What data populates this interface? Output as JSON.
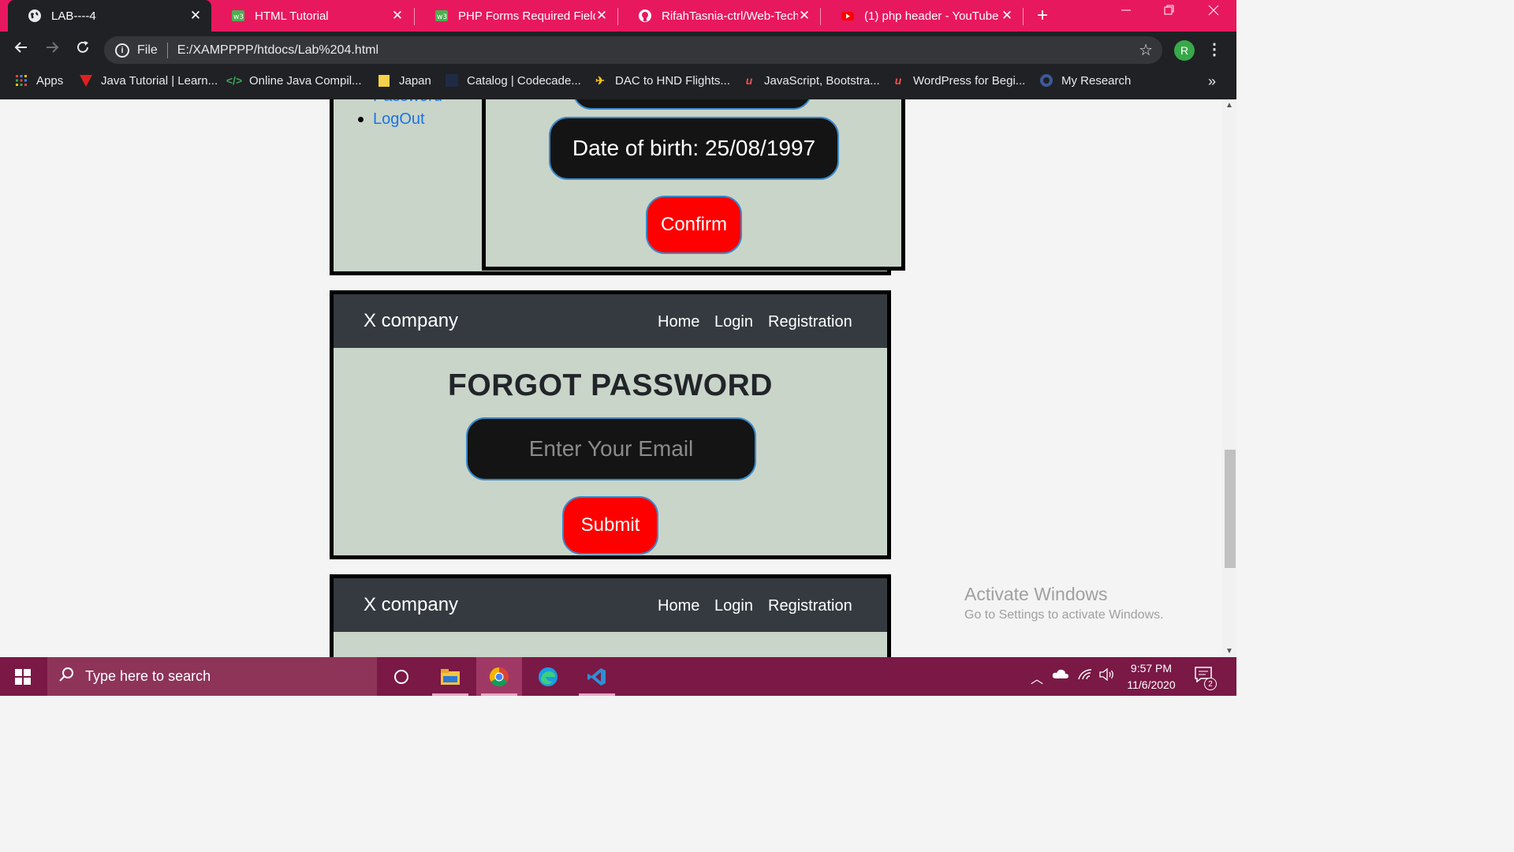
{
  "browser": {
    "tabs": [
      {
        "title": "LAB----4",
        "icon": "globe-icon",
        "active": true
      },
      {
        "title": "HTML Tutorial",
        "icon": "w3schools-icon",
        "active": false
      },
      {
        "title": "PHP Forms Required Fields",
        "icon": "w3schools-icon",
        "active": false
      },
      {
        "title": "RifahTasnia-ctrl/Web-Techn",
        "icon": "github-icon",
        "active": false
      },
      {
        "title": "(1) php header - YouTube",
        "icon": "youtube-icon",
        "active": false
      }
    ],
    "close_glyph": "✕",
    "new_tab_glyph": "+",
    "address": {
      "scheme_label": "File",
      "url": "E:/XAMPPPP/htdocs/Lab%204.html"
    },
    "profile_initial": "R",
    "bookmarks": [
      {
        "label": "Apps",
        "icon": "apps-grid-icon"
      },
      {
        "label": "Java Tutorial | Learn...",
        "icon": "javatpoint-icon"
      },
      {
        "label": "Online Java Compil...",
        "icon": "code-icon"
      },
      {
        "label": "Japan",
        "icon": "folder-icon"
      },
      {
        "label": "Catalog | Codecade...",
        "icon": "codecademy-icon"
      },
      {
        "label": "DAC to HND Flights...",
        "icon": "plane-icon"
      },
      {
        "label": "JavaScript, Bootstra...",
        "icon": "udemy-icon"
      },
      {
        "label": "WordPress for Begi...",
        "icon": "udemy-icon"
      },
      {
        "label": "My Research",
        "icon": "research-icon"
      }
    ],
    "bookmarks_overflow": "»"
  },
  "page": {
    "sidebar_links": [
      "Password",
      "LogOut"
    ],
    "dob_label": "Date of birth: 25/08/1997",
    "confirm_label": "Confirm",
    "forgot_card": {
      "brand": "X company",
      "nav": [
        "Home",
        "Login",
        "Registration"
      ],
      "heading": "FORGOT PASSWORD",
      "email_placeholder": "Enter Your Email",
      "submit_label": "Submit"
    },
    "next_card": {
      "brand": "X company",
      "nav": [
        "Home",
        "Login",
        "Registration"
      ]
    }
  },
  "watermark": {
    "line1": "Activate Windows",
    "line2": "Go to Settings to activate Windows."
  },
  "taskbar": {
    "search_placeholder": "Type here to search",
    "apps": [
      "cortana-icon",
      "file-explorer-icon",
      "chrome-icon",
      "edge-icon",
      "vscode-icon"
    ],
    "time": "9:57 PM",
    "date": "11/6/2020",
    "notification_count": "2"
  },
  "colors": {
    "tab_strip": "#e8185e",
    "toolbar": "#202124",
    "card_bg": "#c9d5c9",
    "navbar": "#343a40",
    "button_red": "#fe0000",
    "input_dark": "#141414",
    "link": "#1a73e8",
    "taskbar": "#7a1846"
  }
}
